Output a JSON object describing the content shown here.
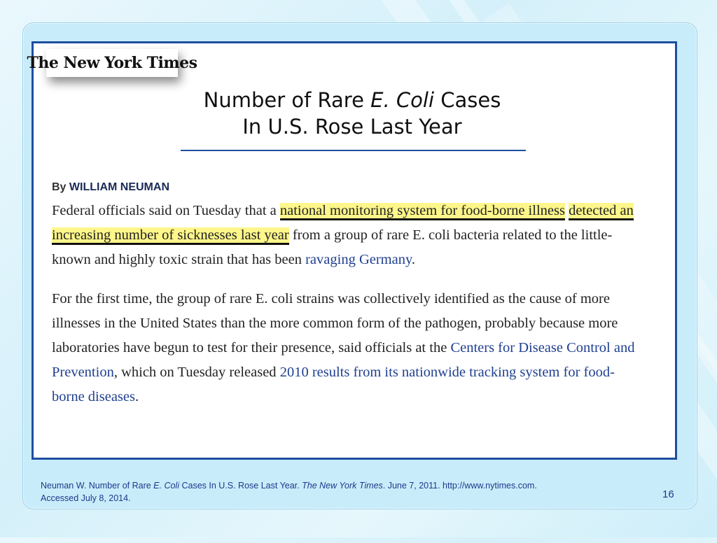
{
  "logo": {
    "text": "The New York Times"
  },
  "title": {
    "part1": "Number of Rare ",
    "italic": "E. Coli",
    "part2": " Cases",
    "line2": "In U.S. Rose Last Year"
  },
  "article": {
    "byline_prefix": "By",
    "byline_name": "WILLIAM NEUMAN",
    "p1": {
      "a": "Federal officials said on Tuesday that a ",
      "highlight1": "national monitoring system for food-borne illness",
      "highlight2": "detected an increasing number of sicknesses last year",
      "b": " from a group of rare E. coli bacteria related to the little-known and highly toxic strain that has been ",
      "link": "ravaging Germany",
      "c": "."
    },
    "p2": {
      "a": "For the first time, the group of rare E. coli strains was collectively identified as the cause of more illnesses in the United States than the more common form of the pathogen, probably because more laboratories have begun to test for their presence, said officials at the ",
      "link1": "Centers for Disease Control and Prevention",
      "b": ", which on Tuesday released ",
      "link2": "2010 results from its nationwide tracking system for food-borne diseases",
      "c": "."
    }
  },
  "citation": {
    "a": "Neuman W. Number of Rare ",
    "italic1": "E. Coli",
    "b": " Cases In U.S. Rose Last Year. ",
    "italic2": "The New York Times",
    "c": ". June 7, 2011. http://www.nytimes.com.",
    "line2": "Accessed July 8, 2014."
  },
  "page_number": "16",
  "colors": {
    "frame_blue": "#1e4ea0",
    "highlight_yellow": "#fdf68a",
    "link_blue": "#1f3f8f",
    "background": "#d5f0fa"
  }
}
